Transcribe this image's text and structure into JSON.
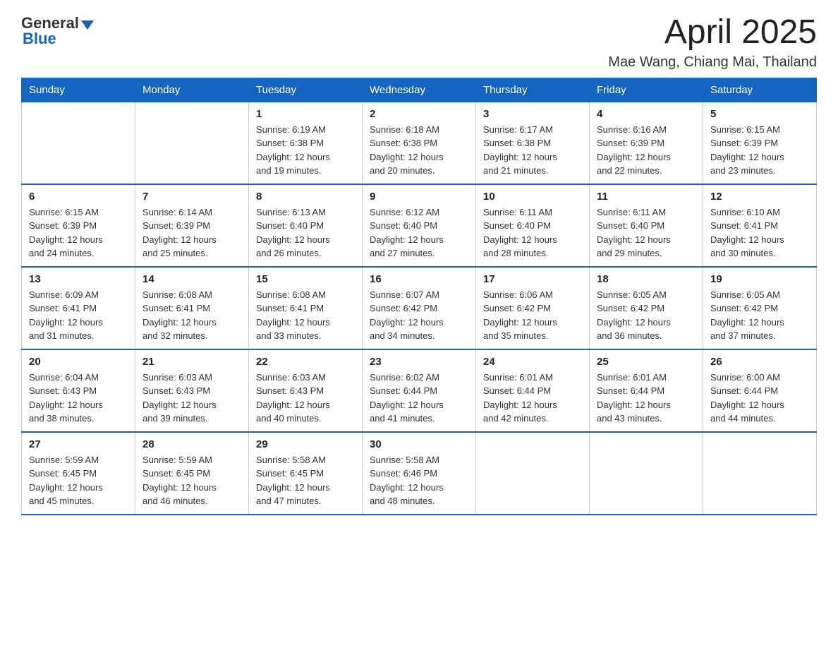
{
  "header": {
    "logo_general": "General",
    "logo_blue": "Blue",
    "month_title": "April 2025",
    "location": "Mae Wang, Chiang Mai, Thailand"
  },
  "calendar": {
    "days_of_week": [
      "Sunday",
      "Monday",
      "Tuesday",
      "Wednesday",
      "Thursday",
      "Friday",
      "Saturday"
    ],
    "weeks": [
      [
        {
          "day": "",
          "info": ""
        },
        {
          "day": "",
          "info": ""
        },
        {
          "day": "1",
          "info": "Sunrise: 6:19 AM\nSunset: 6:38 PM\nDaylight: 12 hours\nand 19 minutes."
        },
        {
          "day": "2",
          "info": "Sunrise: 6:18 AM\nSunset: 6:38 PM\nDaylight: 12 hours\nand 20 minutes."
        },
        {
          "day": "3",
          "info": "Sunrise: 6:17 AM\nSunset: 6:38 PM\nDaylight: 12 hours\nand 21 minutes."
        },
        {
          "day": "4",
          "info": "Sunrise: 6:16 AM\nSunset: 6:39 PM\nDaylight: 12 hours\nand 22 minutes."
        },
        {
          "day": "5",
          "info": "Sunrise: 6:15 AM\nSunset: 6:39 PM\nDaylight: 12 hours\nand 23 minutes."
        }
      ],
      [
        {
          "day": "6",
          "info": "Sunrise: 6:15 AM\nSunset: 6:39 PM\nDaylight: 12 hours\nand 24 minutes."
        },
        {
          "day": "7",
          "info": "Sunrise: 6:14 AM\nSunset: 6:39 PM\nDaylight: 12 hours\nand 25 minutes."
        },
        {
          "day": "8",
          "info": "Sunrise: 6:13 AM\nSunset: 6:40 PM\nDaylight: 12 hours\nand 26 minutes."
        },
        {
          "day": "9",
          "info": "Sunrise: 6:12 AM\nSunset: 6:40 PM\nDaylight: 12 hours\nand 27 minutes."
        },
        {
          "day": "10",
          "info": "Sunrise: 6:11 AM\nSunset: 6:40 PM\nDaylight: 12 hours\nand 28 minutes."
        },
        {
          "day": "11",
          "info": "Sunrise: 6:11 AM\nSunset: 6:40 PM\nDaylight: 12 hours\nand 29 minutes."
        },
        {
          "day": "12",
          "info": "Sunrise: 6:10 AM\nSunset: 6:41 PM\nDaylight: 12 hours\nand 30 minutes."
        }
      ],
      [
        {
          "day": "13",
          "info": "Sunrise: 6:09 AM\nSunset: 6:41 PM\nDaylight: 12 hours\nand 31 minutes."
        },
        {
          "day": "14",
          "info": "Sunrise: 6:08 AM\nSunset: 6:41 PM\nDaylight: 12 hours\nand 32 minutes."
        },
        {
          "day": "15",
          "info": "Sunrise: 6:08 AM\nSunset: 6:41 PM\nDaylight: 12 hours\nand 33 minutes."
        },
        {
          "day": "16",
          "info": "Sunrise: 6:07 AM\nSunset: 6:42 PM\nDaylight: 12 hours\nand 34 minutes."
        },
        {
          "day": "17",
          "info": "Sunrise: 6:06 AM\nSunset: 6:42 PM\nDaylight: 12 hours\nand 35 minutes."
        },
        {
          "day": "18",
          "info": "Sunrise: 6:05 AM\nSunset: 6:42 PM\nDaylight: 12 hours\nand 36 minutes."
        },
        {
          "day": "19",
          "info": "Sunrise: 6:05 AM\nSunset: 6:42 PM\nDaylight: 12 hours\nand 37 minutes."
        }
      ],
      [
        {
          "day": "20",
          "info": "Sunrise: 6:04 AM\nSunset: 6:43 PM\nDaylight: 12 hours\nand 38 minutes."
        },
        {
          "day": "21",
          "info": "Sunrise: 6:03 AM\nSunset: 6:43 PM\nDaylight: 12 hours\nand 39 minutes."
        },
        {
          "day": "22",
          "info": "Sunrise: 6:03 AM\nSunset: 6:43 PM\nDaylight: 12 hours\nand 40 minutes."
        },
        {
          "day": "23",
          "info": "Sunrise: 6:02 AM\nSunset: 6:44 PM\nDaylight: 12 hours\nand 41 minutes."
        },
        {
          "day": "24",
          "info": "Sunrise: 6:01 AM\nSunset: 6:44 PM\nDaylight: 12 hours\nand 42 minutes."
        },
        {
          "day": "25",
          "info": "Sunrise: 6:01 AM\nSunset: 6:44 PM\nDaylight: 12 hours\nand 43 minutes."
        },
        {
          "day": "26",
          "info": "Sunrise: 6:00 AM\nSunset: 6:44 PM\nDaylight: 12 hours\nand 44 minutes."
        }
      ],
      [
        {
          "day": "27",
          "info": "Sunrise: 5:59 AM\nSunset: 6:45 PM\nDaylight: 12 hours\nand 45 minutes."
        },
        {
          "day": "28",
          "info": "Sunrise: 5:59 AM\nSunset: 6:45 PM\nDaylight: 12 hours\nand 46 minutes."
        },
        {
          "day": "29",
          "info": "Sunrise: 5:58 AM\nSunset: 6:45 PM\nDaylight: 12 hours\nand 47 minutes."
        },
        {
          "day": "30",
          "info": "Sunrise: 5:58 AM\nSunset: 6:46 PM\nDaylight: 12 hours\nand 48 minutes."
        },
        {
          "day": "",
          "info": ""
        },
        {
          "day": "",
          "info": ""
        },
        {
          "day": "",
          "info": ""
        }
      ]
    ]
  }
}
